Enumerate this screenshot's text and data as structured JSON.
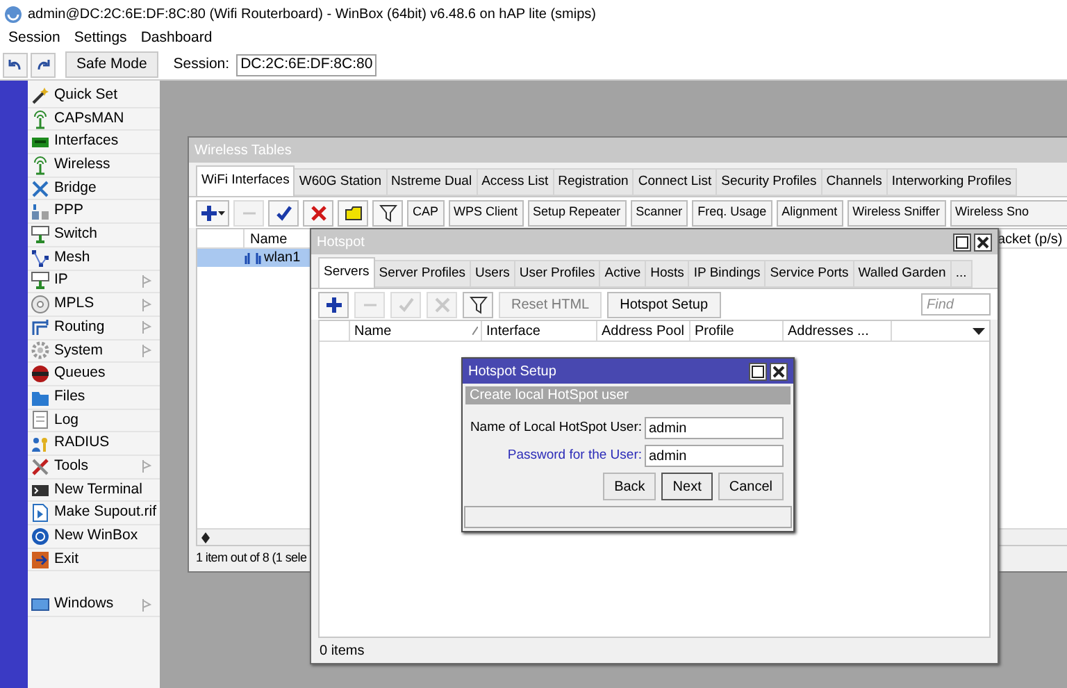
{
  "app_title": "admin@DC:2C:6E:DF:8C:80 (Wifi Routerboard) - WinBox (64bit) v6.48.6 on hAP lite (smips)",
  "menu": [
    "Session",
    "Settings",
    "Dashboard"
  ],
  "toolbar": {
    "safe_mode": "Safe Mode",
    "session_label": "Session:",
    "session_value": "DC:2C:6E:DF:8C:80"
  },
  "sidebar": {
    "items": [
      {
        "label": "Quick Set",
        "submenu": false
      },
      {
        "label": "CAPsMAN",
        "submenu": false
      },
      {
        "label": "Interfaces",
        "submenu": false
      },
      {
        "label": "Wireless",
        "submenu": false
      },
      {
        "label": "Bridge",
        "submenu": false
      },
      {
        "label": "PPP",
        "submenu": false
      },
      {
        "label": "Switch",
        "submenu": false
      },
      {
        "label": "Mesh",
        "submenu": false
      },
      {
        "label": "IP",
        "submenu": true
      },
      {
        "label": "MPLS",
        "submenu": true
      },
      {
        "label": "Routing",
        "submenu": true
      },
      {
        "label": "System",
        "submenu": true
      },
      {
        "label": "Queues",
        "submenu": false
      },
      {
        "label": "Files",
        "submenu": false
      },
      {
        "label": "Log",
        "submenu": false
      },
      {
        "label": "RADIUS",
        "submenu": false
      },
      {
        "label": "Tools",
        "submenu": true
      },
      {
        "label": "New Terminal",
        "submenu": false
      },
      {
        "label": "Make Supout.rif",
        "submenu": false
      },
      {
        "label": "New WinBox",
        "submenu": false
      },
      {
        "label": "Exit",
        "submenu": false
      }
    ],
    "bottom_items": [
      {
        "label": "Windows",
        "submenu": true
      }
    ]
  },
  "wireless_tables": {
    "title": "Wireless Tables",
    "active": false,
    "tabs": [
      {
        "label": "WiFi Interfaces",
        "selected": true
      },
      {
        "label": "W60G Station",
        "selected": false
      },
      {
        "label": "Nstreme Dual",
        "selected": false
      },
      {
        "label": "Access List",
        "selected": false
      },
      {
        "label": "Registration",
        "selected": false
      },
      {
        "label": "Connect List",
        "selected": false
      },
      {
        "label": "Security Profiles",
        "selected": false
      },
      {
        "label": "Channels",
        "selected": false
      },
      {
        "label": "Interworking Profiles",
        "selected": false
      }
    ],
    "buttons": [
      "CAP",
      "WPS Client",
      "Setup Repeater",
      "Scanner",
      "Freq. Usage",
      "Alignment",
      "Wireless Sniffer",
      "Wireless Sno"
    ],
    "columns": [
      "Name",
      "acket (p/s)"
    ],
    "rows": [
      {
        "name": "wlan1",
        "selected": true
      }
    ],
    "status": "1 item out of 8 (1 sele"
  },
  "hotspot": {
    "title": "Hotspot",
    "active": false,
    "tabs": [
      {
        "label": "Servers",
        "selected": true
      },
      {
        "label": "Server Profiles",
        "selected": false
      },
      {
        "label": "Users",
        "selected": false
      },
      {
        "label": "User Profiles",
        "selected": false
      },
      {
        "label": "Active",
        "selected": false
      },
      {
        "label": "Hosts",
        "selected": false
      },
      {
        "label": "IP Bindings",
        "selected": false
      },
      {
        "label": "Service Ports",
        "selected": false
      },
      {
        "label": "Walled Garden",
        "selected": false
      },
      {
        "label": "...",
        "selected": false
      }
    ],
    "buttons": [
      {
        "label": "Reset HTML",
        "disabled": true
      },
      {
        "label": "Hotspot Setup",
        "disabled": false
      }
    ],
    "find": {
      "placeholder": "Find"
    },
    "columns": [
      "Name",
      "Interface",
      "Address Pool",
      "Profile",
      "Addresses ..."
    ],
    "status": "0 items"
  },
  "hotspot_setup": {
    "title": "Hotspot Setup",
    "active": true,
    "subtitle": "Create local HotSpot user",
    "fields": [
      {
        "label": "Name of Local HotSpot User:",
        "value": "admin",
        "color": "#000000"
      },
      {
        "label": "Password for the User:",
        "value": "admin",
        "color": "#2b2bb8"
      }
    ],
    "buttons": [
      {
        "label": "Back",
        "default": false
      },
      {
        "label": "Next",
        "default": true
      },
      {
        "label": "Cancel",
        "default": false
      }
    ]
  }
}
